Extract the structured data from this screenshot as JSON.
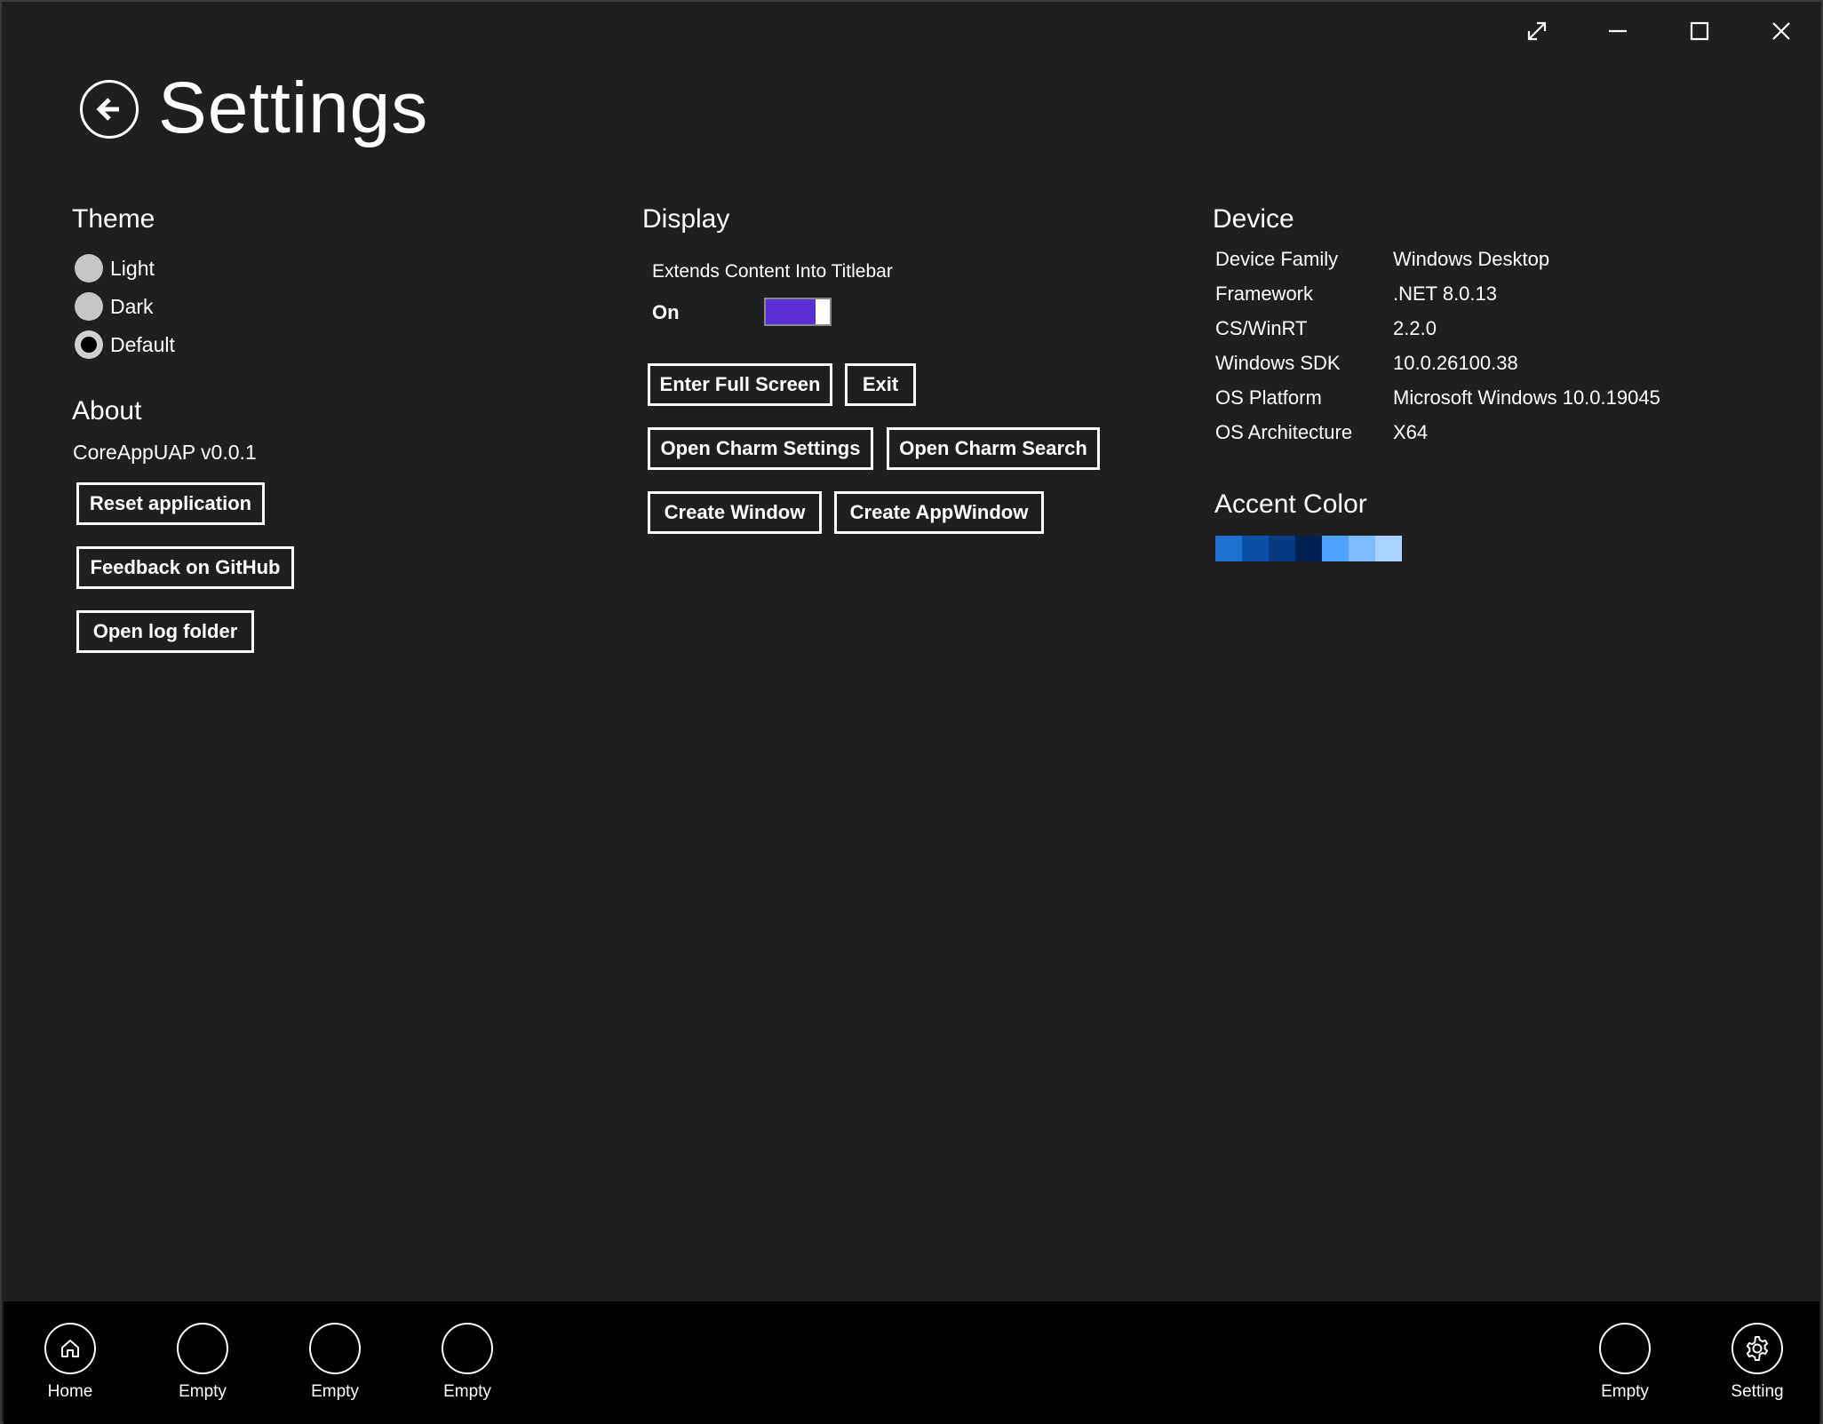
{
  "window": {
    "caption_icons": [
      "fullscreen-icon",
      "minimize-icon",
      "maximize-icon",
      "close-icon"
    ]
  },
  "header": {
    "title": "Settings",
    "back_icon": "arrow-left-icon"
  },
  "theme": {
    "title": "Theme",
    "options": [
      {
        "label": "Light",
        "checked": false
      },
      {
        "label": "Dark",
        "checked": false
      },
      {
        "label": "Default",
        "checked": true
      }
    ]
  },
  "about": {
    "title": "About",
    "version": "CoreAppUAP v0.0.1",
    "buttons": [
      "Reset application",
      "Feedback on GitHub",
      "Open log folder"
    ]
  },
  "display": {
    "title": "Display",
    "toggle_label": "Extends Content Into Titlebar",
    "toggle_state": "On",
    "toggle_on": true,
    "toggle_color": "#5b2fd6",
    "buttons": [
      "Enter Full Screen",
      "Exit",
      "Open Charm Settings",
      "Open Charm Search",
      "Create Window",
      "Create AppWindow"
    ]
  },
  "device": {
    "title": "Device",
    "rows": [
      {
        "key": "Device Family",
        "value": "Windows Desktop"
      },
      {
        "key": "Framework",
        "value": ".NET 8.0.13"
      },
      {
        "key": "CS/WinRT",
        "value": "2.2.0"
      },
      {
        "key": "Windows SDK",
        "value": "10.0.26100.38"
      },
      {
        "key": "OS Platform",
        "value": "Microsoft Windows 10.0.19045"
      },
      {
        "key": "OS Architecture",
        "value": "X64"
      }
    ]
  },
  "accent": {
    "title": "Accent Color",
    "swatches": [
      "#1e6fd0",
      "#0b4fa8",
      "#063a82",
      "#022050",
      "#4da3ff",
      "#7dbcff",
      "#a8d2ff"
    ]
  },
  "bottom_nav": {
    "items": [
      {
        "label": "Home",
        "icon": "home-icon"
      },
      {
        "label": "Empty",
        "icon": "empty-circle-icon"
      },
      {
        "label": "Empty",
        "icon": "empty-circle-icon"
      },
      {
        "label": "Empty",
        "icon": "empty-circle-icon"
      },
      {
        "label": "Empty",
        "icon": "empty-circle-icon"
      },
      {
        "label": "Setting",
        "icon": "gear-icon"
      }
    ]
  }
}
